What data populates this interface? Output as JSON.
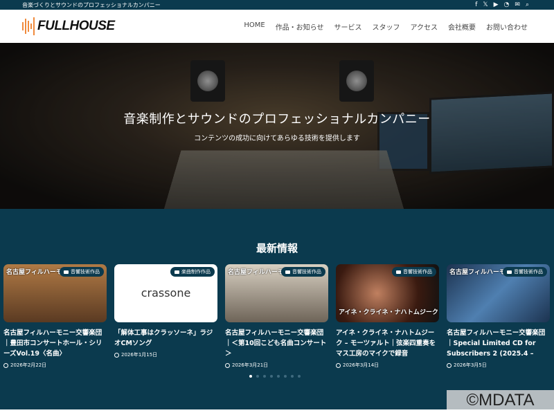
{
  "topbar": {
    "tagline": "音楽づくりとサウンドのプロフェッショナルカンパニー",
    "icons": [
      "facebook-icon",
      "x-icon",
      "youtube-icon",
      "rss-icon",
      "mail-icon",
      "search-icon"
    ]
  },
  "header": {
    "logo": "FULLHOUSE",
    "nav": [
      "HOME",
      "作品・お知らせ",
      "サービス",
      "スタッフ",
      "アクセス",
      "会社概要",
      "お問い合わせ"
    ]
  },
  "hero": {
    "title": "音楽制作とサウンドのプロフェッショナルカンパニー",
    "subtitle": "コンテンツの成功に向けてあらゆる技術を提供します"
  },
  "news": {
    "heading": "最新情報",
    "cards": [
      {
        "category": "音響技術作品",
        "overlay": "名古屋フィルハーモ",
        "title": "名古屋フィルハーモニー交響楽団｜豊田市コンサートホール・シリーズVol.19〈名曲〉",
        "date": "2026年2月22日"
      },
      {
        "category": "楽曲制作作品",
        "overlay": "crassone",
        "title": "「解体工事はクラッソーネ」ラジオCMソング",
        "date": "2026年1月15日"
      },
      {
        "category": "音響技術作品",
        "overlay": "名古屋フィルハーモ",
        "title": "名古屋フィルハーモニー交響楽団｜＜第10回こども名曲コンサート＞",
        "date": "2026年3月21日"
      },
      {
        "category": "音響技術作品",
        "overlay": "アイネ・クライネ・ナハトムジーク",
        "title": "アイネ・クライネ・ナハトムジーク – モーツァルト｜弦楽四重奏をマス工房のマイクで録音",
        "date": "2026年3月14日"
      },
      {
        "category": "音響技術作品",
        "overlay": "名古屋フィルハーモ",
        "title": "名古屋フィルハーモニー交響楽団｜Special Limited CD for Subscribers 2 (2025.4 –",
        "date": "2026年3月5日"
      }
    ],
    "pages": 8,
    "current_page": 1
  },
  "watermark": "©MDATA"
}
